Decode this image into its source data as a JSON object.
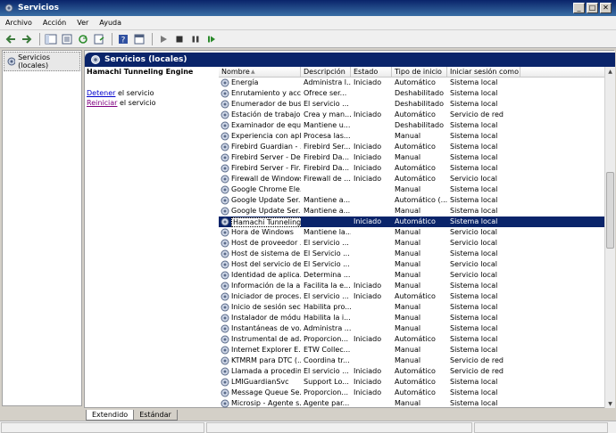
{
  "window": {
    "title": "Servicios"
  },
  "menu": [
    "Archivo",
    "Acción",
    "Ver",
    "Ayuda"
  ],
  "nav": {
    "item": "Servicios (locales)"
  },
  "header": {
    "title": "Servicios (locales)"
  },
  "detail": {
    "service_name": "Hamachi Tunneling Engine",
    "stop_link": "Detener",
    "stop_suffix": " el servicio",
    "restart_link": "Reiniciar",
    "restart_suffix": " el servicio"
  },
  "columns": [
    "Nombre",
    "Descripción",
    "Estado",
    "Tipo de inicio",
    "Iniciar sesión como"
  ],
  "rows": [
    [
      "Energía",
      "Administra l...",
      "Iniciado",
      "Automático",
      "Sistema local"
    ],
    [
      "Enrutamiento y acc...",
      "Ofrece ser...",
      "",
      "Deshabilitado",
      "Sistema local"
    ],
    [
      "Enumerador de bus...",
      "El servicio ...",
      "",
      "Deshabilitado",
      "Sistema local"
    ],
    [
      "Estación de trabajo",
      "Crea y man...",
      "Iniciado",
      "Automático",
      "Servicio de red"
    ],
    [
      "Examinador de equi...",
      "Mantiene u...",
      "",
      "Deshabilitado",
      "Sistema local"
    ],
    [
      "Experiencia con apli...",
      "Procesa las...",
      "",
      "Manual",
      "Sistema local"
    ],
    [
      "Firebird Guardian - ...",
      "Firebird Ser...",
      "Iniciado",
      "Automático",
      "Sistema local"
    ],
    [
      "Firebird Server - De...",
      "Firebird Da...",
      "Iniciado",
      "Manual",
      "Sistema local"
    ],
    [
      "Firebird Server - Fir...",
      "Firebird Da...",
      "Iniciado",
      "Automático",
      "Sistema local"
    ],
    [
      "Firewall de Windows",
      "Firewall de ...",
      "Iniciado",
      "Automático",
      "Servicio local"
    ],
    [
      "Google Chrome Ele...",
      "",
      "",
      "Manual",
      "Sistema local"
    ],
    [
      "Google Update Ser...",
      "Mantiene a...",
      "",
      "Automático (...",
      "Sistema local"
    ],
    [
      "Google Update Ser...",
      "Mantiene a...",
      "",
      "Manual",
      "Sistema local"
    ],
    [
      "Hamachi Tunneling Engine",
      "",
      "Iniciado",
      "Automático",
      "Sistema local"
    ],
    [
      "Hora de Windows",
      "Mantiene la...",
      "",
      "Manual",
      "Servicio local"
    ],
    [
      "Host de proveedor ...",
      "El servicio ...",
      "",
      "Manual",
      "Servicio local"
    ],
    [
      "Host de sistema de ...",
      "El Servicio ...",
      "",
      "Manual",
      "Sistema local"
    ],
    [
      "Host del servicio de...",
      "El Servicio ...",
      "",
      "Manual",
      "Servicio local"
    ],
    [
      "Identidad de aplica...",
      "Determina ...",
      "",
      "Manual",
      "Servicio local"
    ],
    [
      "Información de la a...",
      "Facilita la e...",
      "Iniciado",
      "Manual",
      "Sistema local"
    ],
    [
      "Iniciador de proces...",
      "El servicio ...",
      "Iniciado",
      "Automático",
      "Sistema local"
    ],
    [
      "Inicio de sesión sec...",
      "Habilita pro...",
      "",
      "Manual",
      "Sistema local"
    ],
    [
      "Instalador de módu...",
      "Habilita la i...",
      "",
      "Manual",
      "Sistema local"
    ],
    [
      "Instantáneas de vo...",
      "Administra ...",
      "",
      "Manual",
      "Sistema local"
    ],
    [
      "Instrumental de ad...",
      "Proporcion...",
      "Iniciado",
      "Automático",
      "Sistema local"
    ],
    [
      "Internet Explorer E...",
      "ETW Collec...",
      "",
      "Manual",
      "Sistema local"
    ],
    [
      "KTMRM para DTC (...",
      "Coordina tr...",
      "",
      "Manual",
      "Servicio de red"
    ],
    [
      "Llamada a procedim...",
      "El servicio ...",
      "Iniciado",
      "Automático",
      "Servicio de red"
    ],
    [
      "LMIGuardianSvc",
      "Support Lo...",
      "Iniciado",
      "Automático",
      "Sistema local"
    ],
    [
      "Message Queue Se...",
      "Proporcion...",
      "Iniciado",
      "Automático",
      "Sistema local"
    ],
    [
      "Microsip - Agente s...",
      "Agente par...",
      "",
      "Manual",
      "Sistema local"
    ]
  ],
  "selected_row": 13,
  "tabs": [
    "Extendido",
    "Estándar"
  ]
}
